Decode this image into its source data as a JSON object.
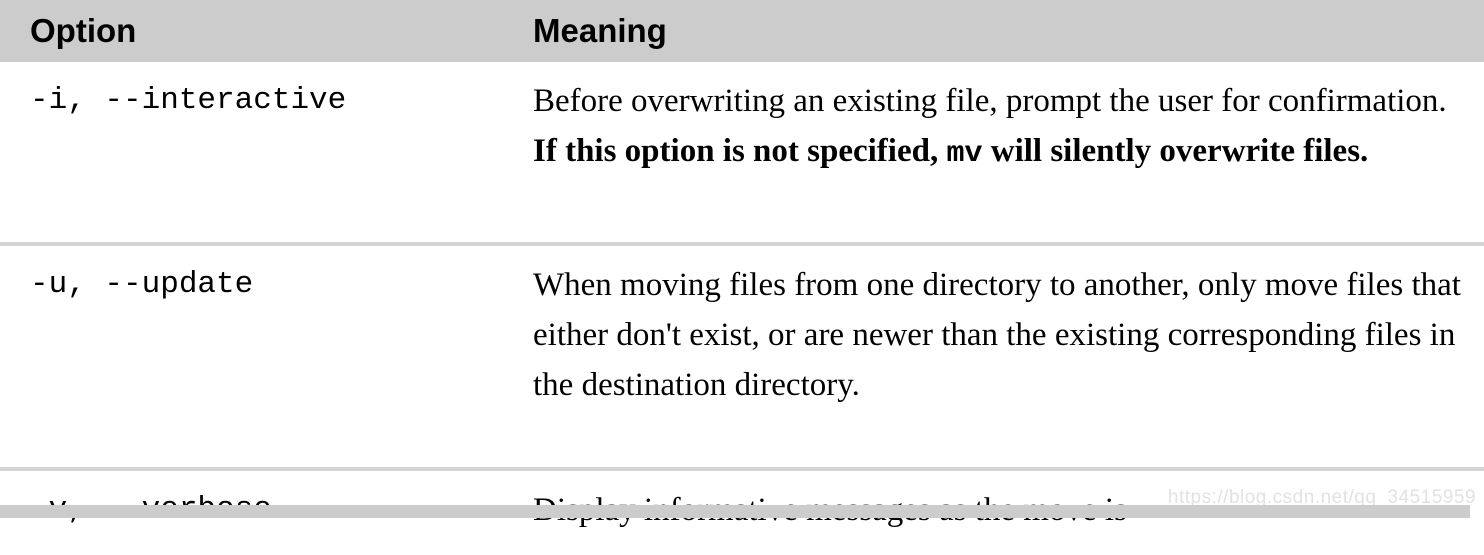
{
  "table": {
    "columns": [
      {
        "key": "option",
        "label": "Option"
      },
      {
        "key": "meaning",
        "label": "Meaning"
      }
    ],
    "rows": [
      {
        "option": "-i, --interactive",
        "meaning_plain": "Before overwriting an existing file, prompt the user for confirmation.  If this option is not specified, mv will silently overwrite files.",
        "meaning_parts": {
          "lead": "Before overwriting an existing file, prompt the user for confirmation.  ",
          "bold_1": "If this option is not specified, ",
          "code": "mv",
          "bold_2": " will silently overwrite files."
        }
      },
      {
        "option": "-u, --update",
        "meaning_plain": "When moving files from one directory to another, only move files that either don't exist, or are newer than the existing corresponding files in the destination directory.",
        "meaning_parts": {
          "lead": "When moving files from one directory to another, only move files that either don't exist, or are newer than the existing corresponding files in the destination directory.",
          "bold_1": "",
          "code": "",
          "bold_2": ""
        }
      },
      {
        "option": "-v, --verbose",
        "meaning_plain": "Display informative messages as the move is",
        "meaning_parts": {
          "lead": "Display informative messages as the move is",
          "bold_1": "",
          "code": "",
          "bold_2": ""
        }
      }
    ]
  },
  "watermark": {
    "text": "https://blog.csdn.net/qq_34515959"
  },
  "colors": {
    "header_background": "#cccccc",
    "row_divider": "#d4d4d4",
    "bottom_band": "#cccccc",
    "text": "#000000",
    "watermark_text": "#e2e2e2",
    "page_background": "#ffffff"
  }
}
